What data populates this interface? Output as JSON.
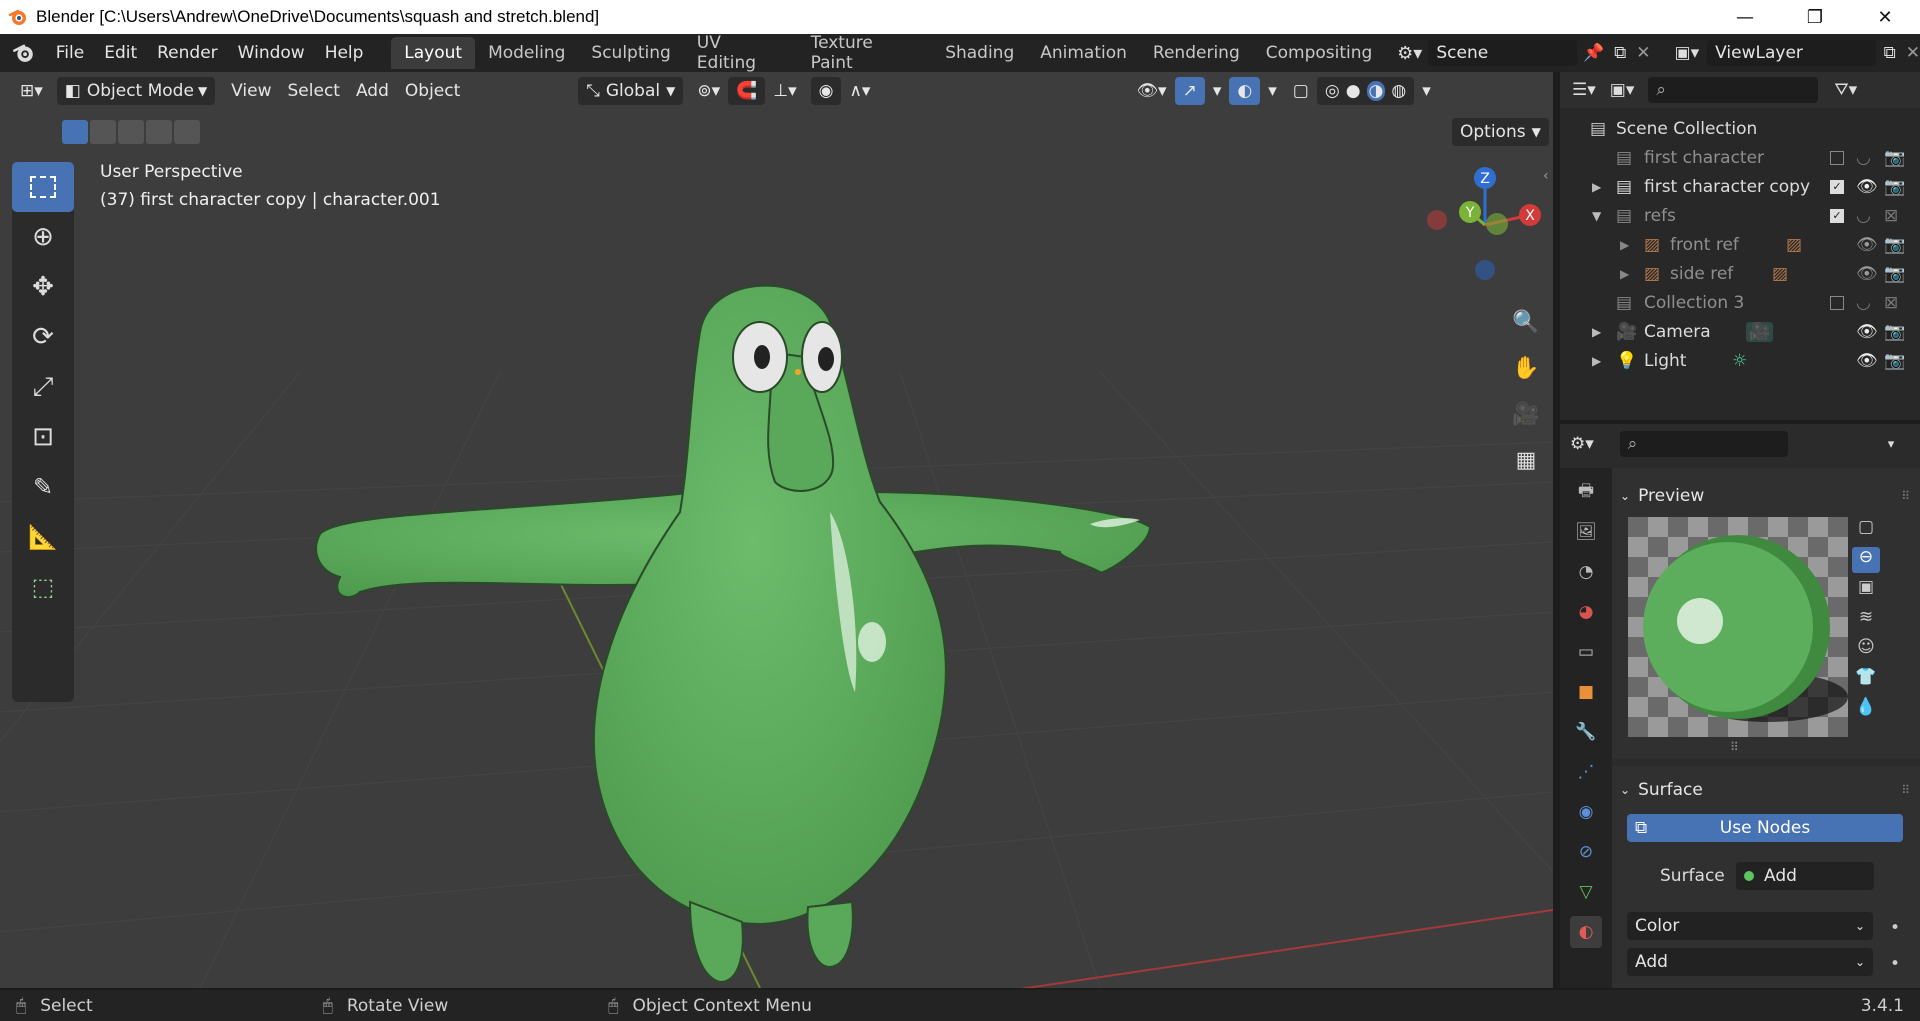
{
  "window": {
    "title": "Blender [C:\\Users\\Andrew\\OneDrive\\Documents\\squash and stretch.blend]",
    "minimize": "—",
    "maximize": "❐",
    "close": "✕"
  },
  "menu": [
    "File",
    "Edit",
    "Render",
    "Window",
    "Help"
  ],
  "workspaces": [
    "Layout",
    "Modeling",
    "Sculpting",
    "UV Editing",
    "Texture Paint",
    "Shading",
    "Animation",
    "Rendering",
    "Compositing"
  ],
  "active_workspace": "Layout",
  "scene": {
    "name": "Scene"
  },
  "view_layer": {
    "name": "ViewLayer"
  },
  "viewport_header": {
    "mode": "Object Mode",
    "menus": [
      "View",
      "Select",
      "Add",
      "Object"
    ],
    "orientation": "Global",
    "options": "Options"
  },
  "viewport": {
    "perspective": "User Perspective",
    "object_info": "(37) first character copy | character.001",
    "gizmo": {
      "z": "Z",
      "y": "Y",
      "x": "X"
    },
    "character_color": "#5aa85a",
    "grid_color": "#3d3d3d"
  },
  "outliner": {
    "root": "Scene Collection",
    "items": [
      {
        "name": "first character",
        "dim": true
      },
      {
        "name": "first character copy",
        "dim": false
      },
      {
        "name": "refs",
        "dim": true
      },
      {
        "name": "front ref",
        "dim": true
      },
      {
        "name": "side ref",
        "dim": true
      },
      {
        "name": "Collection 3",
        "dim": true
      },
      {
        "name": "Camera",
        "dim": false
      },
      {
        "name": "Light",
        "dim": false
      }
    ]
  },
  "properties": {
    "preview_label": "Preview",
    "surface_label": "Surface",
    "use_nodes": "Use Nodes",
    "surface_field_label": "Surface",
    "surface_value": "Add",
    "color_dropdown": "Color",
    "add_dropdown": "Add",
    "material_color": "#5cad5c"
  },
  "statusbar": {
    "select": "Select",
    "rotate": "Rotate View",
    "context": "Object Context Menu",
    "version": "3.4.1"
  }
}
